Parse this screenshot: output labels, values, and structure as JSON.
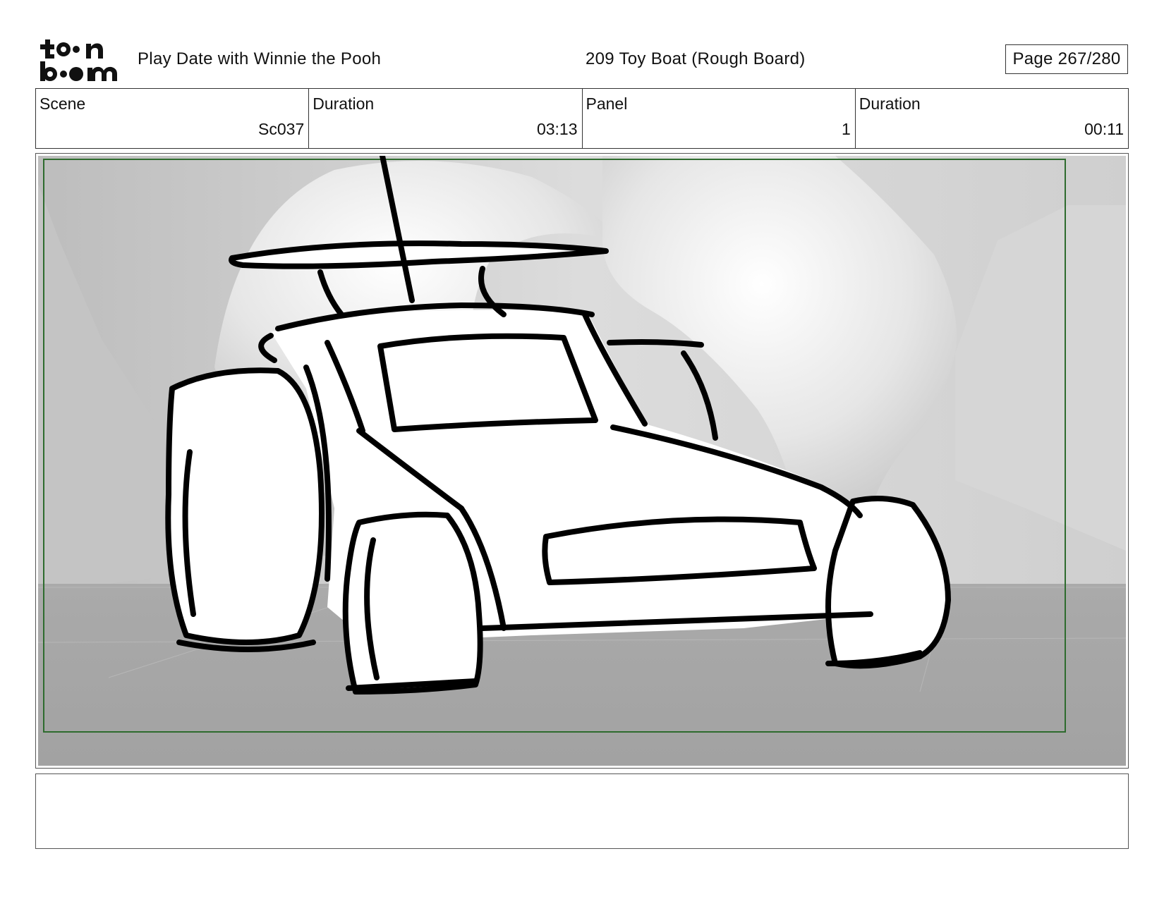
{
  "header": {
    "project_title": "Play Date with Winnie the Pooh",
    "episode_title": "209 Toy Boat (Rough Board)",
    "page": "Page 267/280"
  },
  "logo": {
    "name": "toon boom",
    "icon": "toon-boom-logo"
  },
  "info": {
    "scene_label": "Scene",
    "scene_value": "Sc037",
    "scene_duration_label": "Duration",
    "scene_duration_value": "03:13",
    "panel_label": "Panel",
    "panel_value": "1",
    "panel_duration_label": "Duration",
    "panel_duration_value": "00:11"
  },
  "panel": {
    "description": "",
    "frame_color": "#2e6b2e"
  },
  "notes": {
    "text": ""
  }
}
